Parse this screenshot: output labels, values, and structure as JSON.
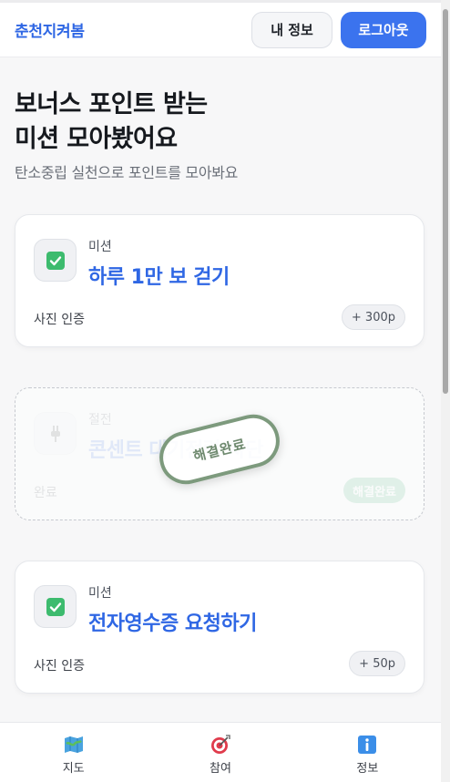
{
  "header": {
    "brand": "춘천지켜봄",
    "my_info_label": "내 정보",
    "logout_label": "로그아웃"
  },
  "hero": {
    "title": "보너스 포인트 받는\n미션 모아봤어요",
    "subtitle": "탄소중립 실천으로 포인트를 모아봐요"
  },
  "missions": [
    {
      "eyebrow": "미션",
      "title": "하루 1만 보 걷기",
      "footer": "사진 인증",
      "points": "+ 300p",
      "icon": "checkbox-icon",
      "status": "active"
    },
    {
      "eyebrow": "절전",
      "title": "콘센트 대기전력 차단",
      "footer": "완료",
      "points": "해결완료",
      "icon": "plug-icon",
      "status": "completed",
      "stamp": "해결완료"
    },
    {
      "eyebrow": "미션",
      "title": "전자영수증 요청하기",
      "footer": "사진 인증",
      "points": "+ 50p",
      "icon": "checkbox-icon",
      "status": "active"
    }
  ],
  "bottom_nav": [
    {
      "label": "지도",
      "icon": "map-icon"
    },
    {
      "label": "참여",
      "icon": "target-icon"
    },
    {
      "label": "정보",
      "icon": "info-icon"
    }
  ],
  "colors": {
    "accent": "#2f67e4",
    "logout_bg": "#3b73ee",
    "check_green": "#3dbb6e",
    "stamp_green": "#7d9a7d"
  }
}
